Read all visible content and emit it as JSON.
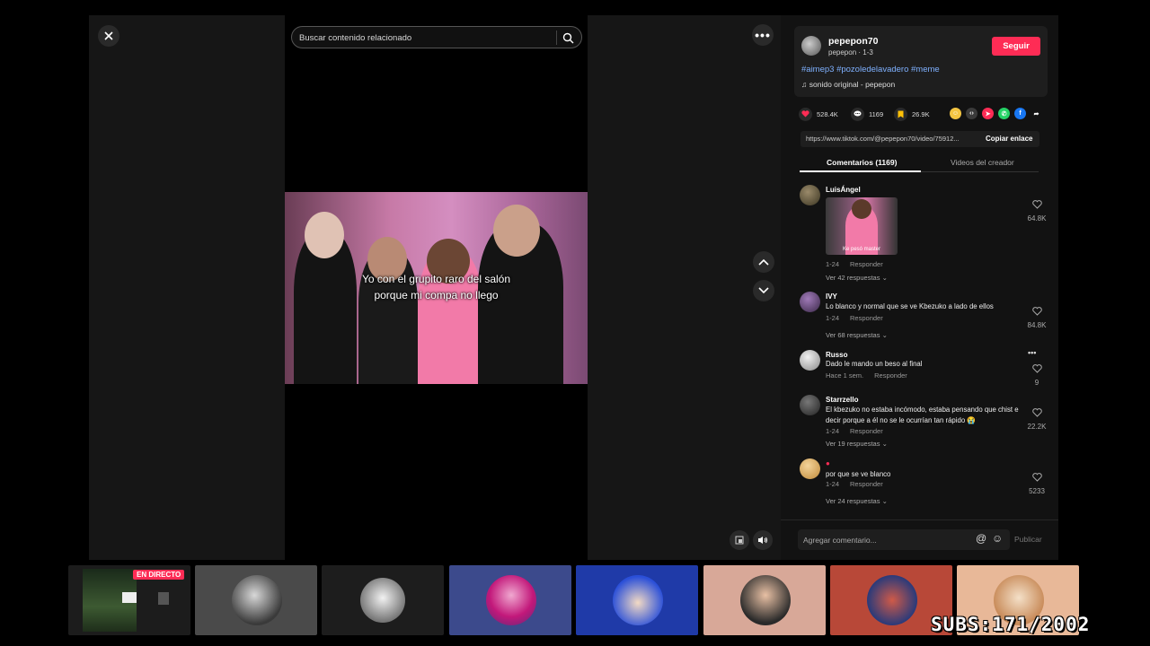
{
  "search": {
    "placeholder": "Buscar contenido relacionado"
  },
  "video": {
    "caption_line1": "Yo con el grupito raro del salón",
    "caption_line2": "porque mi compa no llego"
  },
  "author": {
    "username": "pepepon70",
    "subline": "pepepon · 1-3",
    "follow_label": "Seguir",
    "hashtags": "#aimep3 #pozoledelavadero #meme",
    "sound": "sonido original - pepepon"
  },
  "stats": {
    "likes": "528.4K",
    "comments": "1169",
    "saves": "26.9K"
  },
  "link": {
    "url": "https://www.tiktok.com/@pepepon70/video/75912...",
    "copy_label": "Copiar enlace"
  },
  "tabs": [
    {
      "label": "Comentarios (1169)"
    },
    {
      "label": "Videos del creador"
    }
  ],
  "comments": [
    {
      "user": "LuisÁngel",
      "text": "",
      "gif_label": "Ke pesó master",
      "time": "1-24",
      "reply": "Responder",
      "likes": "64.8K",
      "more": "Ver 42 respuestas"
    },
    {
      "user": "IVY",
      "text": "Lo blanco y normal que se ve Kbezuko a lado de ellos",
      "time": "1-24",
      "reply": "Responder",
      "likes": "84.8K",
      "more": "Ver 68 respuestas"
    },
    {
      "user": "Russo",
      "text": "Dado le mando un beso al final",
      "time": "Hace 1 sem.",
      "reply": "Responder",
      "likes": "9",
      "more": ""
    },
    {
      "user": "Starrzello",
      "text": "El kbezuko no estaba incómodo, estaba pensando que chist e decir porque a él no se le ocurrían tan rápido 😭",
      "time": "1-24",
      "reply": "Responder",
      "likes": "22.2K",
      "more": "Ver 19 respuestas"
    },
    {
      "user": "",
      "text": "por que se ve blanco",
      "time": "1-24",
      "reply": "Responder",
      "likes": "5233",
      "more": "Ver 24 respuestas"
    }
  ],
  "comment_input": {
    "placeholder": "Agregar comentario...",
    "publish_label": "Publicar"
  },
  "stream": {
    "live_label": "EN DIRECTO",
    "subs": "SUBS:171/2002"
  },
  "colors": {
    "accent": "#fe2c55",
    "hashtag": "#7fb1ff",
    "panel": "#121212"
  },
  "icons": [
    "close-icon",
    "search-icon",
    "more-icon",
    "chevron-up-icon",
    "chevron-down-icon",
    "volume-icon",
    "heart-icon",
    "comment-icon",
    "bookmark-icon",
    "share-icon",
    "music-icon",
    "at-icon",
    "emoji-icon"
  ]
}
